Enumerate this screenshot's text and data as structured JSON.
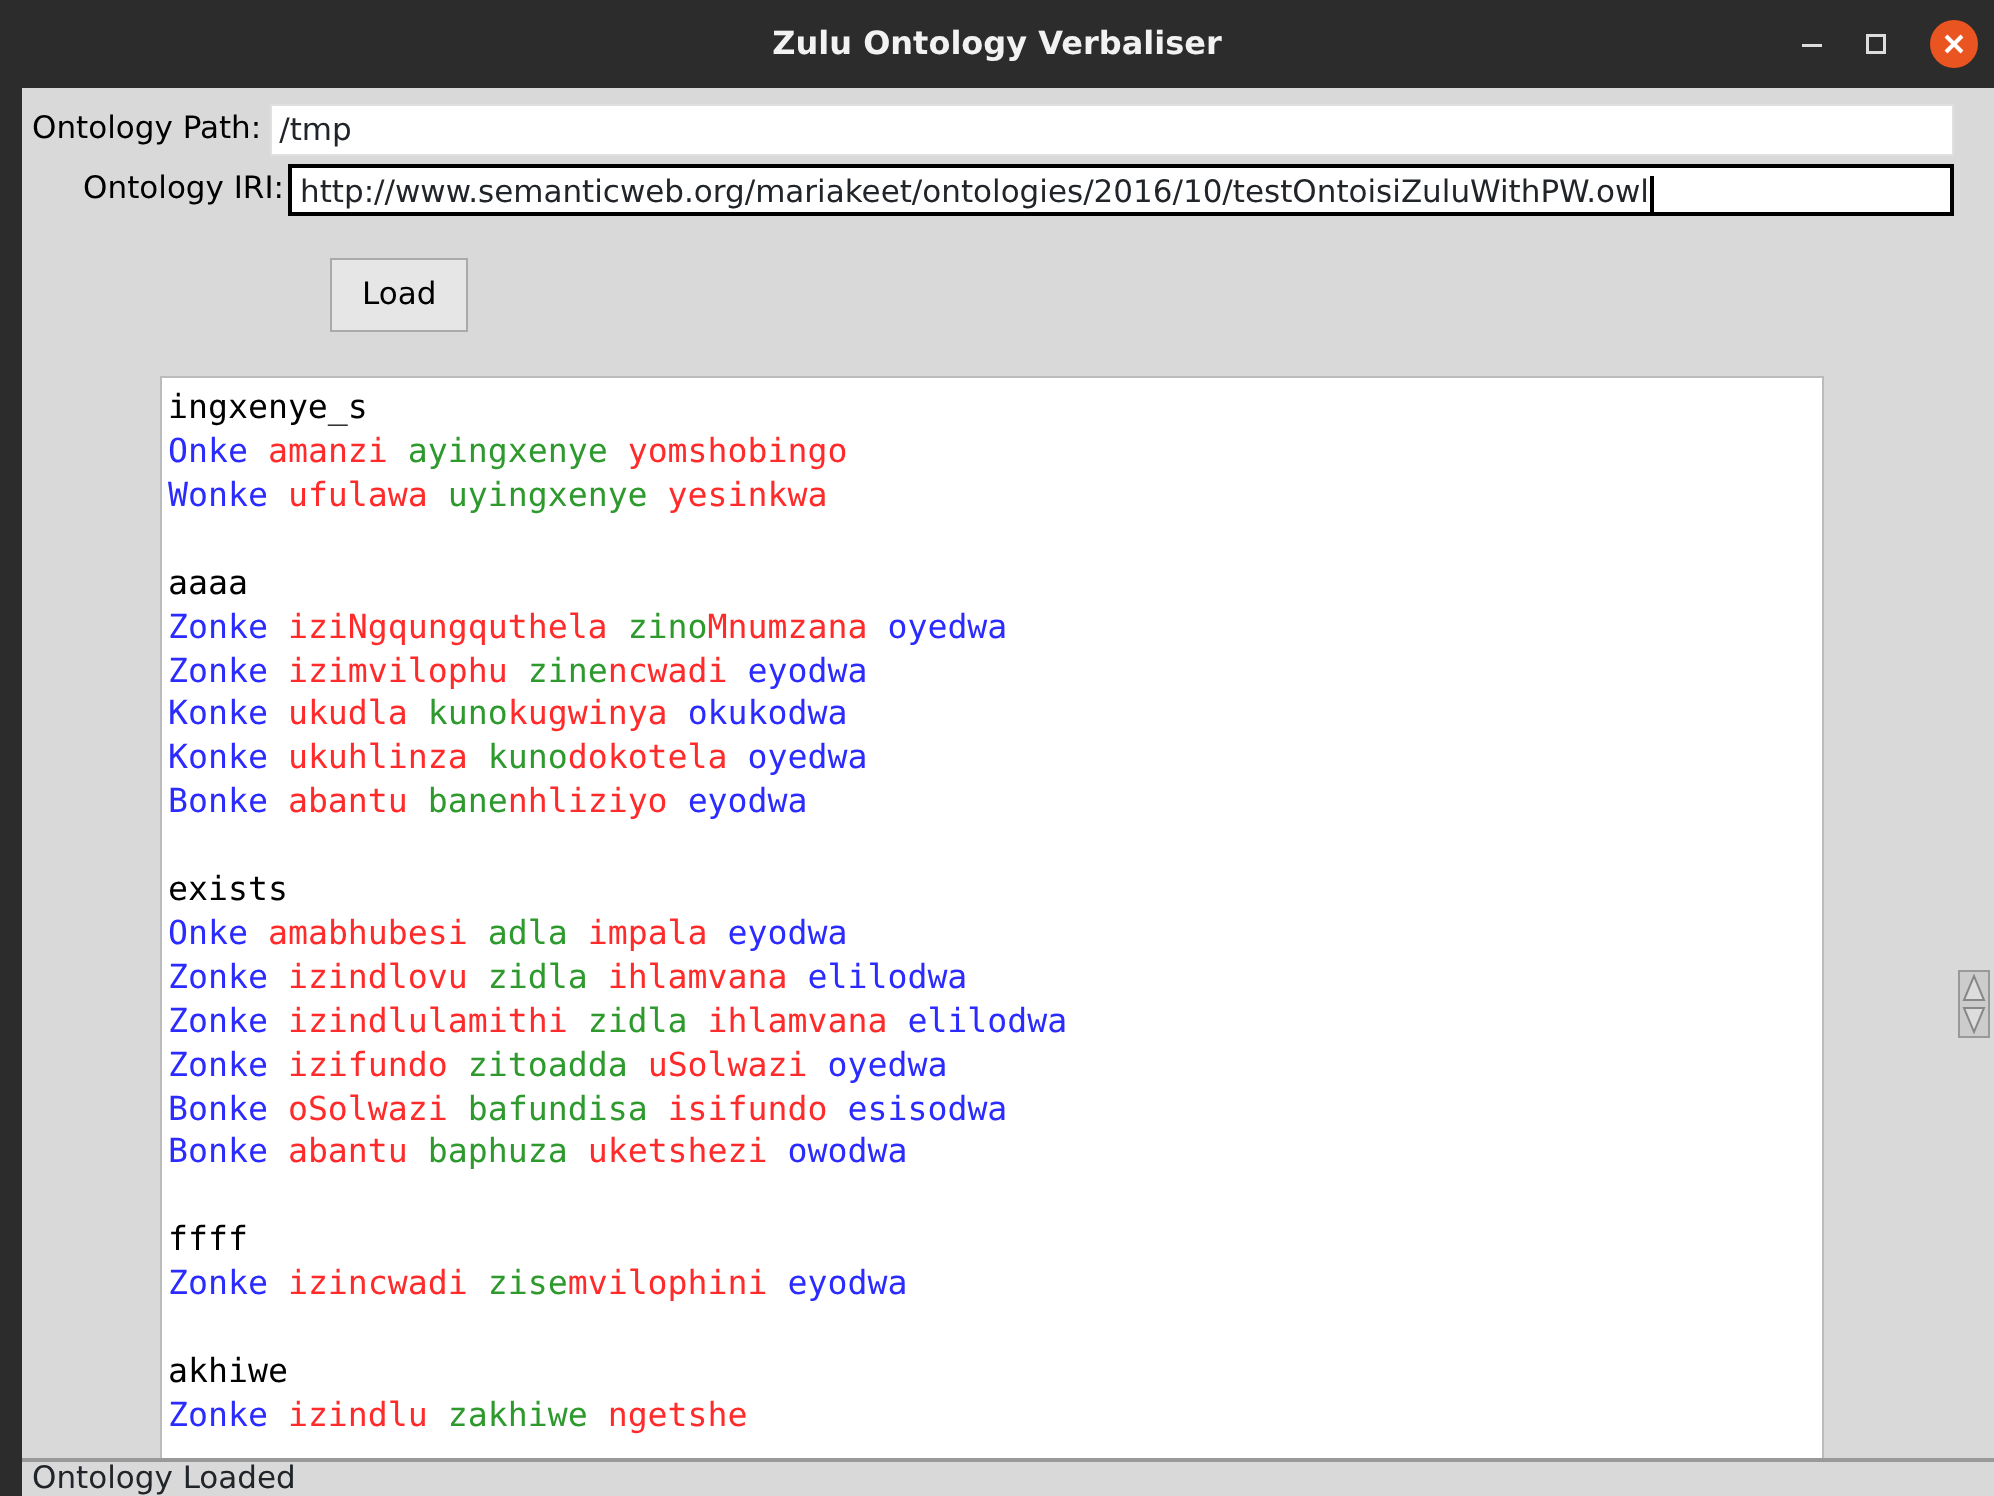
{
  "window": {
    "title": "Zulu Ontology Verbaliser"
  },
  "form": {
    "path_label": "Ontology Path:",
    "path_value": "/tmp",
    "iri_label": "Ontology IRI:",
    "iri_value": "http://www.semanticweb.org/mariakeet/ontologies/2016/10/testOntoisiZuluWithPW.owl",
    "load_button": "Load"
  },
  "output": {
    "groups": [
      {
        "heading": "ingxenye_s",
        "lines": [
          [
            [
              {
                "text": "Onke",
                "color": "#2b2bff"
              }
            ],
            [
              {
                "text": "amanzi",
                "color": "#ff2b2b"
              }
            ],
            [
              {
                "text": "ayingxenye",
                "color": "#2e9a2e"
              }
            ],
            [
              {
                "text": "yomshobingo",
                "color": "#ff2b2b"
              }
            ]
          ],
          [
            [
              {
                "text": "Wonke",
                "color": "#2b2bff"
              }
            ],
            [
              {
                "text": "ufulawa",
                "color": "#ff2b2b"
              }
            ],
            [
              {
                "text": "uyingxenye",
                "color": "#2e9a2e"
              }
            ],
            [
              {
                "text": "yesinkwa",
                "color": "#ff2b2b"
              }
            ]
          ]
        ]
      },
      {
        "heading": "aaaa",
        "lines": [
          [
            [
              {
                "text": "Zonke",
                "color": "#2b2bff"
              }
            ],
            [
              {
                "text": "iziNgqungquthela",
                "color": "#ff2b2b"
              }
            ],
            [
              {
                "text": "zino",
                "color": "#2e9a2e"
              },
              {
                "text": "Mnumzana",
                "color": "#ff2b2b"
              }
            ],
            [
              {
                "text": "oyedwa",
                "color": "#2b2bff"
              }
            ]
          ],
          [
            [
              {
                "text": "Zonke",
                "color": "#2b2bff"
              }
            ],
            [
              {
                "text": "izimvilophu",
                "color": "#ff2b2b"
              }
            ],
            [
              {
                "text": "zine",
                "color": "#2e9a2e"
              },
              {
                "text": "ncwadi",
                "color": "#ff2b2b"
              }
            ],
            [
              {
                "text": "eyodwa",
                "color": "#2b2bff"
              }
            ]
          ],
          [
            [
              {
                "text": "Konke",
                "color": "#2b2bff"
              }
            ],
            [
              {
                "text": "ukudla",
                "color": "#ff2b2b"
              }
            ],
            [
              {
                "text": "kuno",
                "color": "#2e9a2e"
              },
              {
                "text": "kugwinya",
                "color": "#ff2b2b"
              }
            ],
            [
              {
                "text": "okukodwa",
                "color": "#2b2bff"
              }
            ]
          ],
          [
            [
              {
                "text": "Konke",
                "color": "#2b2bff"
              }
            ],
            [
              {
                "text": "ukuhlinza",
                "color": "#ff2b2b"
              }
            ],
            [
              {
                "text": "kuno",
                "color": "#2e9a2e"
              },
              {
                "text": "dokotela",
                "color": "#ff2b2b"
              }
            ],
            [
              {
                "text": "oyedwa",
                "color": "#2b2bff"
              }
            ]
          ],
          [
            [
              {
                "text": "Bonke",
                "color": "#2b2bff"
              }
            ],
            [
              {
                "text": "abantu",
                "color": "#ff2b2b"
              }
            ],
            [
              {
                "text": "bane",
                "color": "#2e9a2e"
              },
              {
                "text": "nhliziyo",
                "color": "#ff2b2b"
              }
            ],
            [
              {
                "text": "eyodwa",
                "color": "#2b2bff"
              }
            ]
          ]
        ]
      },
      {
        "heading": "exists",
        "lines": [
          [
            [
              {
                "text": "Onke",
                "color": "#2b2bff"
              }
            ],
            [
              {
                "text": "amabhubesi",
                "color": "#ff2b2b"
              }
            ],
            [
              {
                "text": "adla",
                "color": "#2e9a2e"
              }
            ],
            [
              {
                "text": "impala",
                "color": "#ff2b2b"
              }
            ],
            [
              {
                "text": "eyodwa",
                "color": "#2b2bff"
              }
            ]
          ],
          [
            [
              {
                "text": "Zonke",
                "color": "#2b2bff"
              }
            ],
            [
              {
                "text": "izindlovu",
                "color": "#ff2b2b"
              }
            ],
            [
              {
                "text": "zidla",
                "color": "#2e9a2e"
              }
            ],
            [
              {
                "text": "ihlamvana",
                "color": "#ff2b2b"
              }
            ],
            [
              {
                "text": "elilodwa",
                "color": "#2b2bff"
              }
            ]
          ],
          [
            [
              {
                "text": "Zonke",
                "color": "#2b2bff"
              }
            ],
            [
              {
                "text": "izindlulamithi",
                "color": "#ff2b2b"
              }
            ],
            [
              {
                "text": "zidla",
                "color": "#2e9a2e"
              }
            ],
            [
              {
                "text": "ihlamvana",
                "color": "#ff2b2b"
              }
            ],
            [
              {
                "text": "elilodwa",
                "color": "#2b2bff"
              }
            ]
          ],
          [
            [
              {
                "text": "Zonke",
                "color": "#2b2bff"
              }
            ],
            [
              {
                "text": "izifundo",
                "color": "#ff2b2b"
              }
            ],
            [
              {
                "text": "zitoadda",
                "color": "#2e9a2e"
              }
            ],
            [
              {
                "text": "uSolwazi",
                "color": "#ff2b2b"
              }
            ],
            [
              {
                "text": "oyedwa",
                "color": "#2b2bff"
              }
            ]
          ],
          [
            [
              {
                "text": "Bonke",
                "color": "#2b2bff"
              }
            ],
            [
              {
                "text": "oSolwazi",
                "color": "#ff2b2b"
              }
            ],
            [
              {
                "text": "bafundisa",
                "color": "#2e9a2e"
              }
            ],
            [
              {
                "text": "isifundo",
                "color": "#ff2b2b"
              }
            ],
            [
              {
                "text": "esisodwa",
                "color": "#2b2bff"
              }
            ]
          ],
          [
            [
              {
                "text": "Bonke",
                "color": "#2b2bff"
              }
            ],
            [
              {
                "text": "abantu",
                "color": "#ff2b2b"
              }
            ],
            [
              {
                "text": "baphuza",
                "color": "#2e9a2e"
              }
            ],
            [
              {
                "text": "uketshezi",
                "color": "#ff2b2b"
              }
            ],
            [
              {
                "text": "owodwa",
                "color": "#2b2bff"
              }
            ]
          ]
        ]
      },
      {
        "heading": "ffff",
        "lines": [
          [
            [
              {
                "text": "Zonke",
                "color": "#2b2bff"
              }
            ],
            [
              {
                "text": "izincwadi",
                "color": "#ff2b2b"
              }
            ],
            [
              {
                "text": "zise",
                "color": "#2e9a2e"
              },
              {
                "text": "mvilophini",
                "color": "#ff2b2b"
              }
            ],
            [
              {
                "text": "eyodwa",
                "color": "#2b2bff"
              }
            ]
          ]
        ]
      },
      {
        "heading": "akhiwe",
        "lines": [
          [
            [
              {
                "text": "Zonke",
                "color": "#2b2bff"
              }
            ],
            [
              {
                "text": "izindlu",
                "color": "#ff2b2b"
              }
            ],
            [
              {
                "text": "zakhiwe",
                "color": "#2e9a2e"
              }
            ],
            [
              {
                "text": "ngetshe",
                "color": "#ff2b2b"
              }
            ]
          ]
        ]
      }
    ]
  },
  "status_bar": "Ontology Loaded"
}
